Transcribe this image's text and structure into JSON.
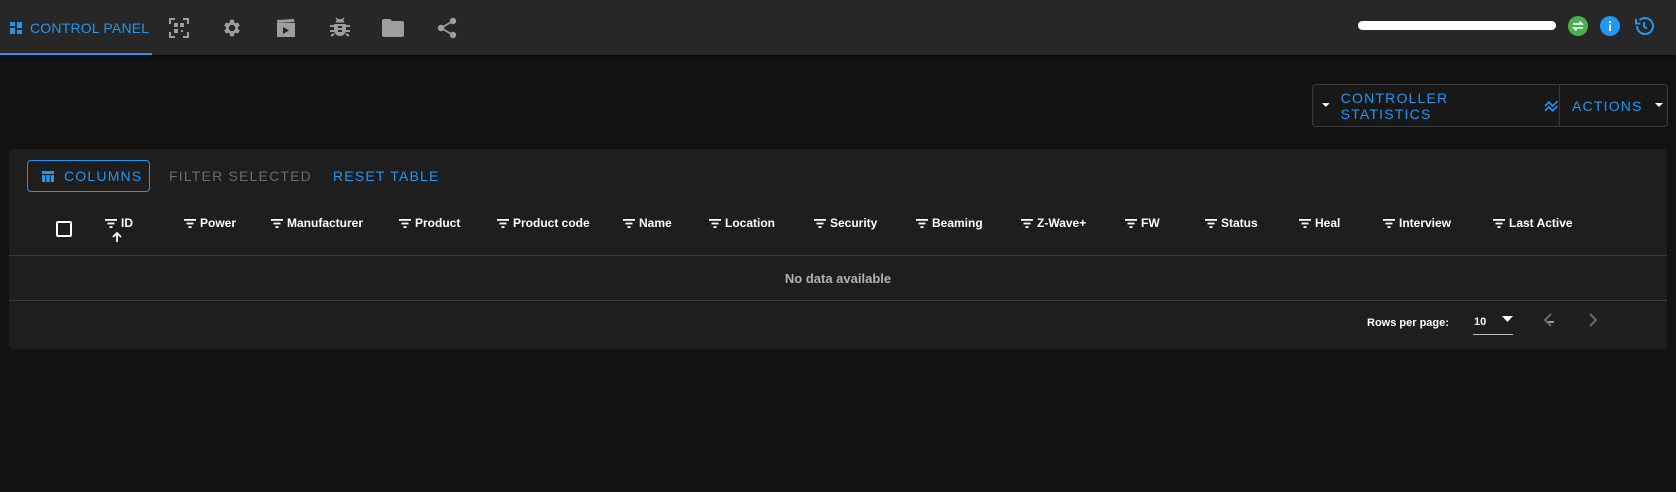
{
  "nav": {
    "active_tab_label": "CONTROL PANEL",
    "tabs": [
      {
        "icon": "qr-scan-icon"
      },
      {
        "icon": "gear-icon"
      },
      {
        "icon": "clapperboard-icon"
      },
      {
        "icon": "bug-icon"
      },
      {
        "icon": "folder-icon"
      },
      {
        "icon": "share-icon"
      }
    ]
  },
  "status": {
    "progress_percent": 100,
    "icons": [
      "sync-status-icon",
      "info-icon",
      "history-icon"
    ]
  },
  "actions_group": {
    "controller_statistics": "CONTROLLER STATISTICS",
    "actions": "ACTIONS"
  },
  "toolbar": {
    "columns": "COLUMNS",
    "filter_selected": "FILTER SELECTED",
    "reset_table": "RESET TABLE"
  },
  "table": {
    "columns": [
      "ID",
      "Power",
      "Manufacturer",
      "Product",
      "Product code",
      "Name",
      "Location",
      "Security",
      "Beaming",
      "Z-Wave+",
      "FW",
      "Status",
      "Heal",
      "Interview",
      "Last Active"
    ],
    "empty_message": "No data available"
  },
  "footer": {
    "rows_per_page_label": "Rows per page:",
    "rows_per_page_value": "10",
    "page_info": "–"
  },
  "colors": {
    "accent": "#2196f3",
    "sync_green": "#4caf50",
    "info_blue": "#2196f3",
    "background": "#121212",
    "surface": "#1e1e1e",
    "topbar": "#272727"
  }
}
